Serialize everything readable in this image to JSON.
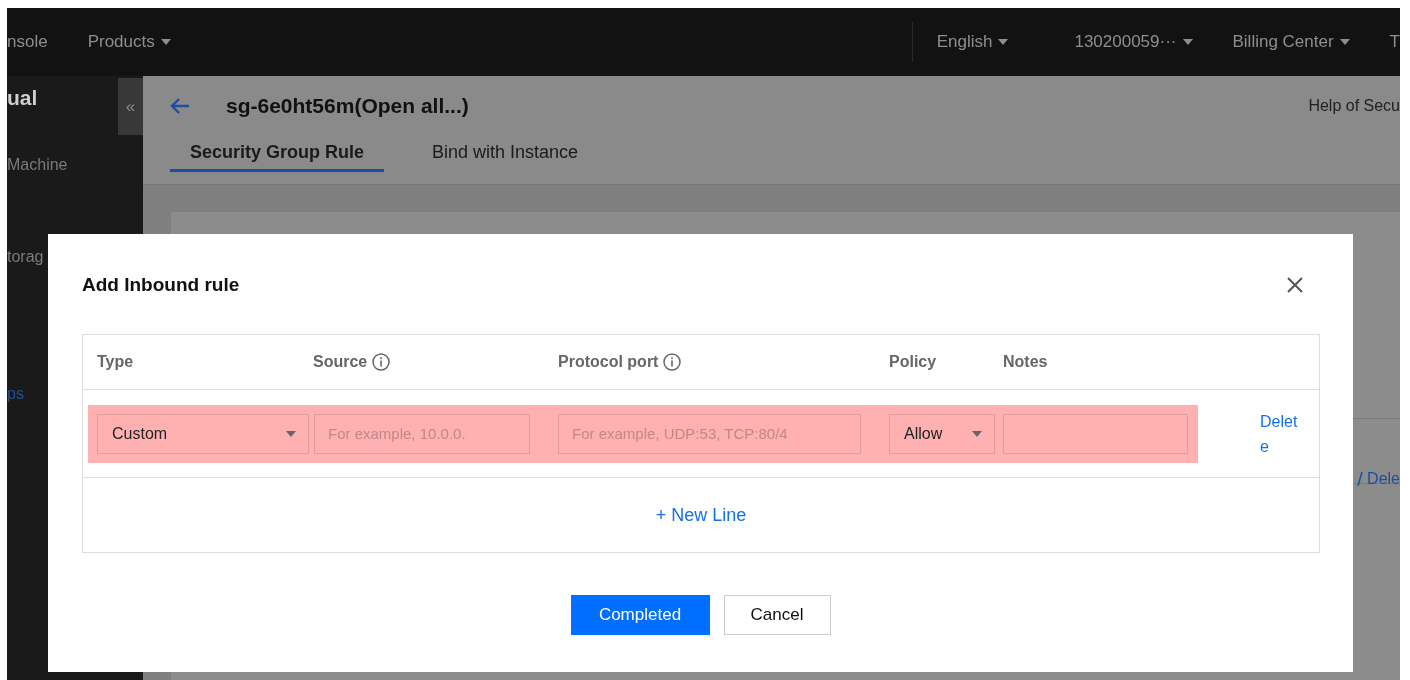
{
  "top_bar": {
    "left_items": [
      {
        "label": "nsole",
        "dropdown": false
      },
      {
        "label": "Products",
        "dropdown": true
      }
    ],
    "right_items": [
      {
        "label": "English",
        "dropdown": true
      },
      {
        "label": "130200059···",
        "dropdown": true
      },
      {
        "label": "Billing Center",
        "dropdown": true
      },
      {
        "label": "T",
        "dropdown": false
      }
    ]
  },
  "sidebar": {
    "title": "ual",
    "collapse": "«",
    "items": [
      {
        "label": "Machine",
        "selected": false
      },
      {
        "label": "torag",
        "selected": false
      },
      {
        "label": "ps",
        "selected": true
      }
    ]
  },
  "page": {
    "title": "sg-6e0ht56m(Open all...)",
    "help": "Help of Secu",
    "tabs": [
      {
        "label": "Security Group Rule",
        "selected": true
      },
      {
        "label": "Bind with Instance",
        "selected": false
      }
    ],
    "row_action": "Dele"
  },
  "dialog": {
    "title": "Add Inbound rule",
    "columns": [
      {
        "label": "Type",
        "info": false
      },
      {
        "label": "Source",
        "info": true
      },
      {
        "label": "Protocol port",
        "info": true
      },
      {
        "label": "Policy",
        "info": false
      },
      {
        "label": "Notes",
        "info": false
      }
    ],
    "rows": [
      {
        "highlighted": true,
        "type": "Custom",
        "source_placeholder": "For example, 10.0.0.",
        "port_placeholder": "For example, UDP:53, TCP:80/4",
        "policy": "Allow",
        "action": "Delete"
      }
    ],
    "add_line": "+ New Line",
    "buttons": [
      {
        "label": "Completed",
        "kind": "primary"
      },
      {
        "label": "Cancel",
        "kind": "secondary"
      }
    ]
  }
}
